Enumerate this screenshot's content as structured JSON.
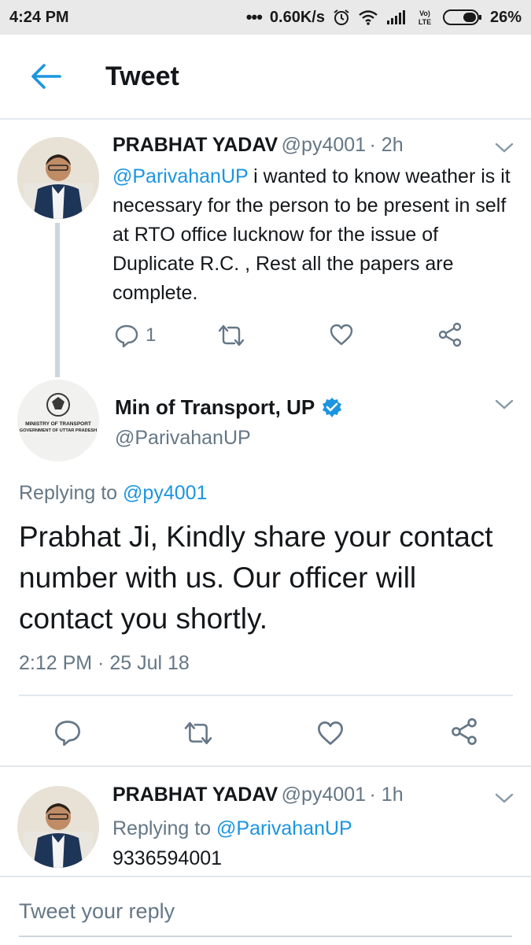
{
  "status_bar": {
    "time": "4:24 PM",
    "network_speed": "0.60K/s",
    "battery_percent": "26%",
    "icons": [
      "more-dots-icon",
      "alarm-icon",
      "wifi-icon",
      "signal-icon",
      "volte-icon",
      "battery-icon"
    ]
  },
  "header": {
    "title": "Tweet",
    "back_icon": "arrow-left-icon"
  },
  "colors": {
    "accent": "#1b95e0",
    "text_primary": "#14171a",
    "text_secondary": "#657786",
    "divider": "#e1e8ed"
  },
  "tweet1": {
    "name": "PRABHAT YADAV",
    "handle": "@py4001",
    "time": "· 2h",
    "mention": "@ParivahanUP",
    "text": " i wanted to know weather is it necessary for the person to be present in self at RTO office lucknow for the issue of Duplicate R.C. , Rest all the papers are complete.",
    "reply_count": "1"
  },
  "main_tweet": {
    "name": "Min of Transport, UP",
    "handle": "@ParivahanUP",
    "verified": true,
    "avatar_text": [
      "MINISTRY OF TRANSPORT",
      "GOVERNMENT OF UTTAR PRADESH"
    ],
    "replying_prefix": "Replying to ",
    "replying_to": "@py4001",
    "text": "Prabhat Ji, Kindly share your contact number with us. Our officer will contact you shortly.",
    "timestamp": "2:12 PM · 25 Jul 18"
  },
  "reply_tweet": {
    "name": "PRABHAT YADAV",
    "handle": "@py4001",
    "time": "· 1h",
    "replying_prefix": "Replying to ",
    "replying_to": "@ParivahanUP",
    "text": "9336594001"
  },
  "composer": {
    "placeholder": "Tweet your reply"
  }
}
